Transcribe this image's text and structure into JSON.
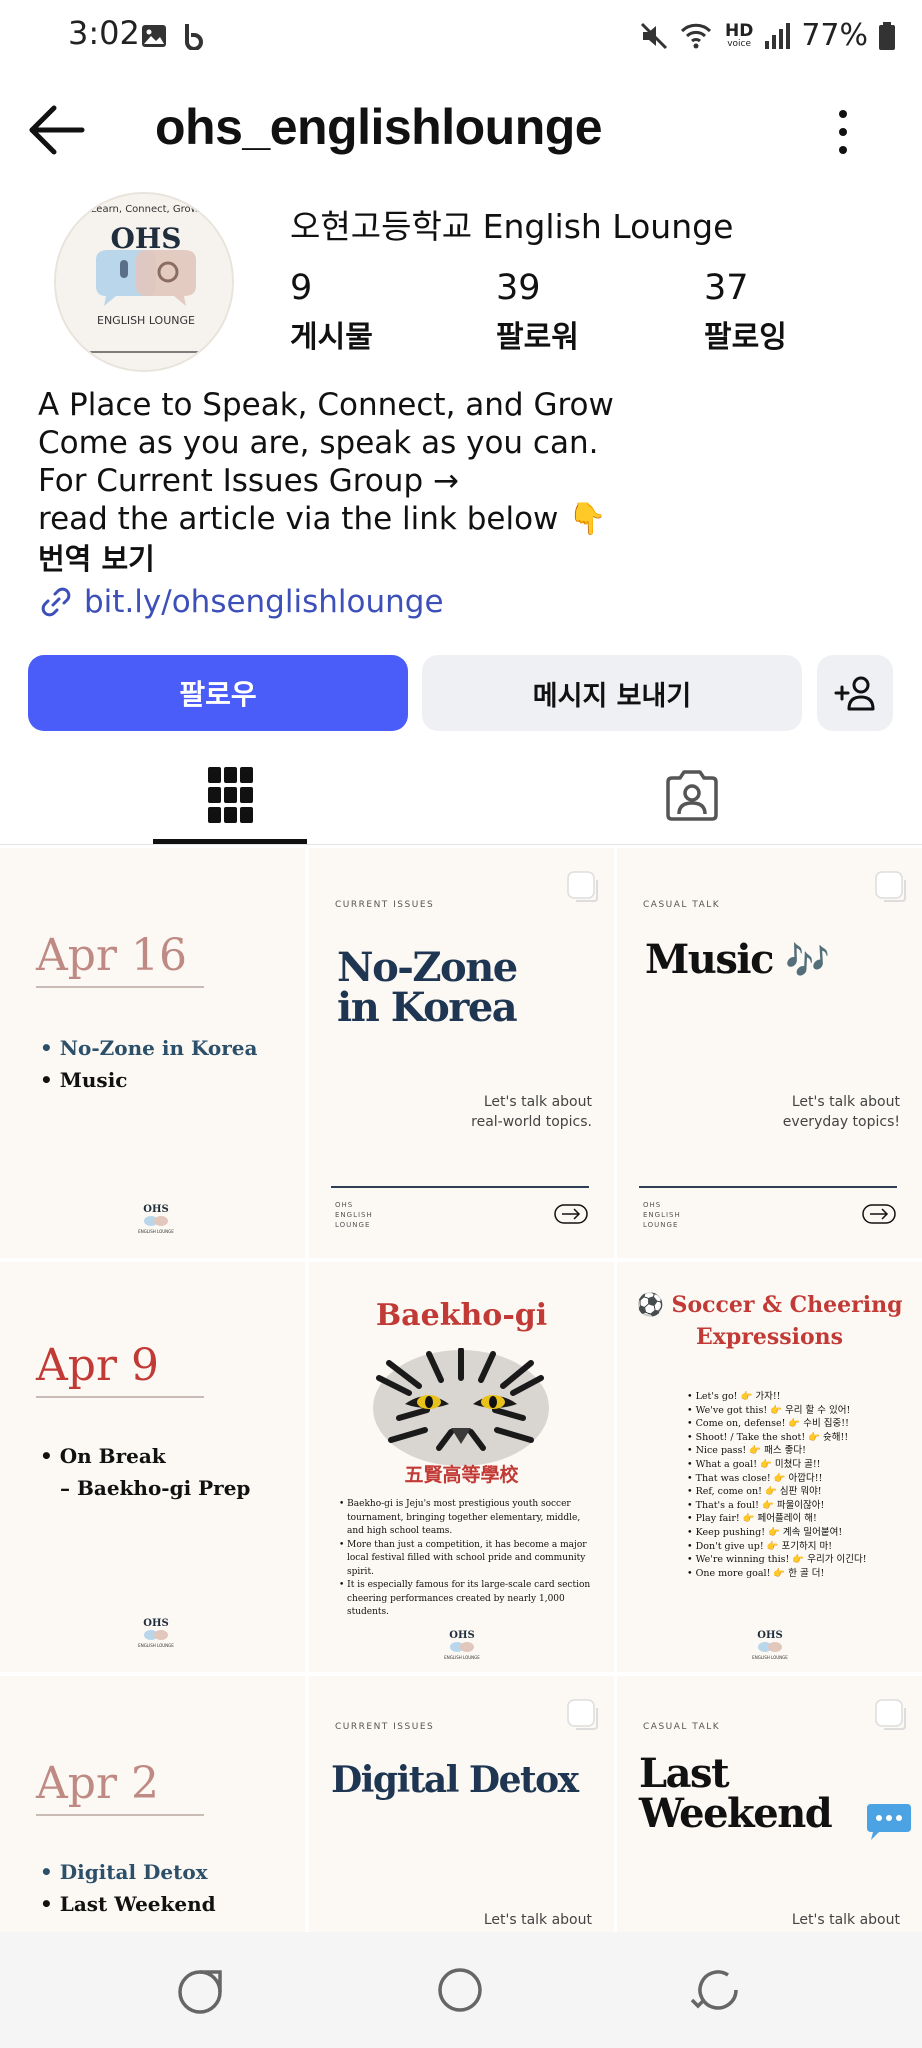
{
  "status_bar": {
    "time": "3:02",
    "hd_label": "HD",
    "voice_label": "voice",
    "battery": "77%"
  },
  "header": {
    "username": "ohs_englishlounge"
  },
  "profile": {
    "display_name": "오현고등학교 English Lounge",
    "avatar": {
      "top_text": "Learn, Connect, Grow.",
      "big_text": "OHS",
      "bottom_text": "ENGLISH LOUNGE"
    },
    "stats": [
      {
        "value": "9",
        "label": "게시물"
      },
      {
        "value": "39",
        "label": "팔로워"
      },
      {
        "value": "37",
        "label": "팔로잉"
      }
    ],
    "bio_lines": [
      "A Place to Speak, Connect, and Grow",
      "Come as you are, speak as you can.",
      "For Current Issues Group →",
      "read the article via the link below 👇"
    ],
    "translate_label": "번역 보기",
    "link": "bit.ly/ohsenglishlounge"
  },
  "actions": {
    "follow": "팔로우",
    "message": "메시지 보내기"
  },
  "tiles": {
    "t1": {
      "date": "Apr 16",
      "items": [
        "No-Zone in Korea",
        "Music"
      ],
      "logo": "OHS",
      "logo_sub": "ENGLISH LOUNGE"
    },
    "t2": {
      "category": "CURRENT ISSUES",
      "title_1": "No-Zone",
      "title_2": "in Korea",
      "sub_1": "Let's talk about",
      "sub_2": "real-world topics.",
      "brand_1": "OHS",
      "brand_2": "ENGLISH",
      "brand_3": "LOUNGE"
    },
    "t3": {
      "category": "CASUAL TALK",
      "title": "Music",
      "emoji": "🎶",
      "sub_1": "Let's talk about",
      "sub_2": "everyday topics!",
      "brand_1": "OHS",
      "brand_2": "ENGLISH",
      "brand_3": "LOUNGE"
    },
    "t4": {
      "date": "Apr 9",
      "items": [
        "On Break",
        "– Baekho-gi Prep"
      ],
      "logo": "OHS",
      "logo_sub": "ENGLISH LOUNGE"
    },
    "t5": {
      "title": "Baekho-gi",
      "caption": "五賢高等學校",
      "bullets": [
        "Baekho-gi is Jeju's most prestigious youth soccer",
        "tournament, bringing together elementary, middle,",
        "and high school teams.",
        "More than just a competition, it has become a major",
        "local festival filled with school pride and community",
        "spirit.",
        "It is especially famous for its large-scale card section",
        "cheering performances created by nearly 1,000",
        "students."
      ],
      "logo": "OHS",
      "logo_sub": "ENGLISH LOUNGE"
    },
    "t6": {
      "title_1": "⚽ Soccer & Cheering",
      "title_2": "Expressions",
      "items": [
        "Let's go! 👉 가자!!",
        "We've got this! 👉 우리 할 수 있어!",
        "Come on, defense! 👉 수비 집중!!",
        "Shoot! / Take the shot! 👉 슛해!!",
        "Nice pass! 👉 패스 좋다!",
        "What a goal! 👉 미쳤다 골!!",
        "That was close! 👉 아깝다!!",
        "Ref, come on! 👉 심판 뭐야!",
        "That's a foul! 👉 파울이잖아!",
        "Play fair! 👉 페어플레이 해!",
        "Keep pushing! 👉 계속 밀어붙여!",
        "Don't give up! 👉 포기하지 마!",
        "We're winning this! 👉 우리가 이긴다!",
        "One more goal! 👉 한 골 더!"
      ],
      "logo": "OHS",
      "logo_sub": "ENGLISH LOUNGE"
    },
    "t7": {
      "date": "Apr 2",
      "items": [
        "Digital Detox",
        "Last Weekend"
      ]
    },
    "t8": {
      "category": "CURRENT ISSUES",
      "title": "Digital Detox",
      "sub_1": "Let's talk about"
    },
    "t9": {
      "category": "CASUAL TALK",
      "title_1": "Last",
      "title_2": "Weekend",
      "sub_1": "Let's talk about"
    }
  },
  "colors": {
    "follow_button": "#4a5df9",
    "link": "#3d4fb8",
    "date_pink": "#c08a84",
    "navy": "#1f3653",
    "red": "#c23a36"
  }
}
